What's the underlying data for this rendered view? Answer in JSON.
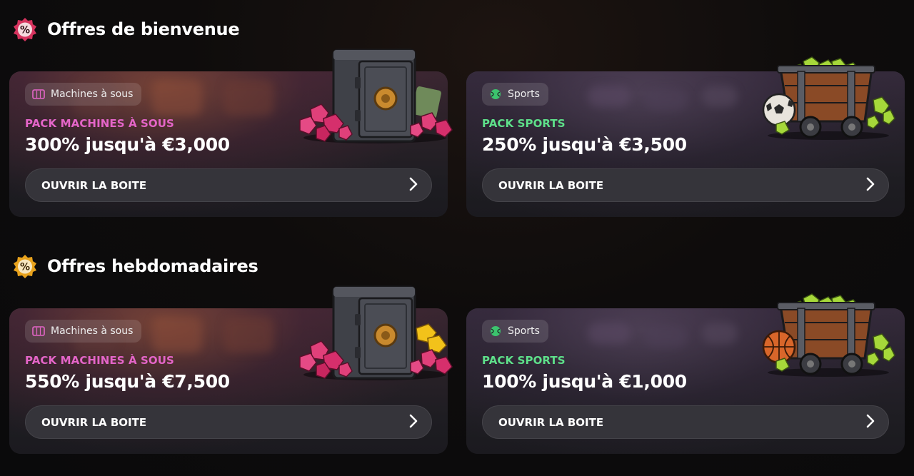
{
  "sections": [
    {
      "title": "Offres de bienvenue",
      "badge_color": "#d6335e",
      "cards": [
        {
          "tag": "Machines à sous",
          "pack": "PACK MACHINES À SOUS",
          "offer": "300% jusqu'à €3,000",
          "button": "OUVRIR LA BOITE"
        },
        {
          "tag": "Sports",
          "pack": "PACK SPORTS",
          "offer": "250% jusqu'à €3,500",
          "button": "OUVRIR LA BOITE"
        }
      ]
    },
    {
      "title": "Offres hebdomadaires",
      "badge_color": "#e8a21c",
      "cards": [
        {
          "tag": "Machines à sous",
          "pack": "PACK MACHINES À SOUS",
          "offer": "550% jusqu'à €7,500",
          "button": "OUVRIR LA BOITE"
        },
        {
          "tag": "Sports",
          "pack": "PACK SPORTS",
          "offer": "100% jusqu'à €1,000",
          "button": "OUVRIR LA BOITE"
        }
      ]
    }
  ],
  "colors": {
    "slots_accent": "#e465c8",
    "sports_accent": "#5ee08a",
    "button_bg": "#35343a"
  },
  "icons": {
    "welcome_badge": "percent-badge-icon",
    "weekly_badge": "percent-badge-icon",
    "slots_tag": "slot-machine-icon",
    "sports_tag": "tennis-ball-icon",
    "button_arrow": "chevron-right-icon",
    "slots_art": "safe-with-gems-icon",
    "sports_art": "mine-cart-with-ball-icon"
  }
}
